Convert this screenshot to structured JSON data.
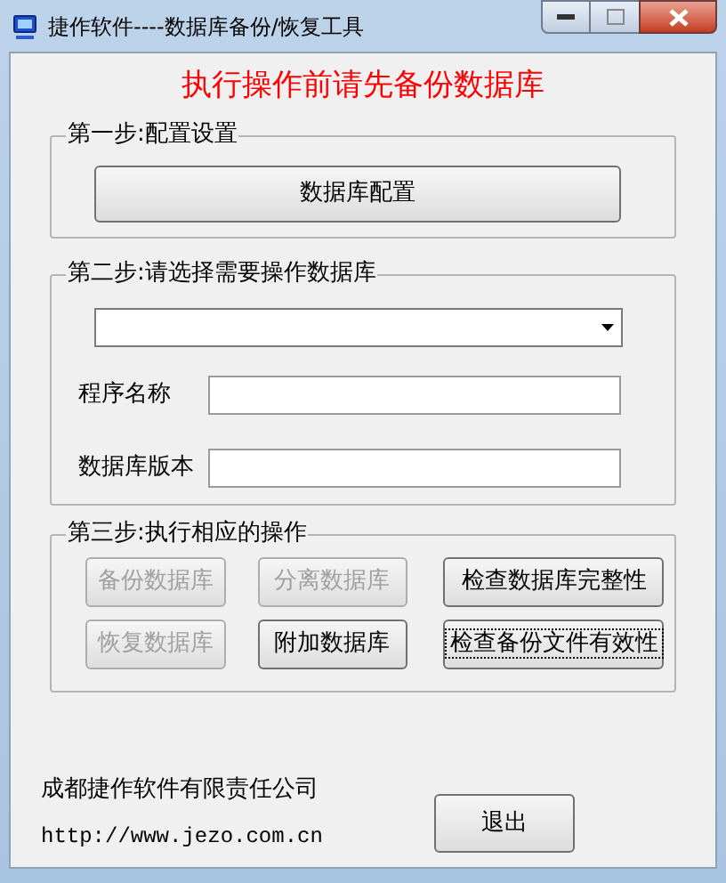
{
  "window": {
    "title": "捷作软件----数据库备份/恢复工具"
  },
  "warning": "执行操作前请先备份数据库",
  "step1": {
    "legend": "第一步:配置设置",
    "button": "数据库配置"
  },
  "step2": {
    "legend": "第二步:请选择需要操作数据库",
    "fields": [
      {
        "label": "程序名称"
      },
      {
        "label": "数据库版本"
      }
    ]
  },
  "step3": {
    "legend": "第三步:执行相应的操作",
    "buttons": [
      {
        "label": "备份数据库",
        "disabled": true,
        "focused": false
      },
      {
        "label": "分离数据库",
        "disabled": true,
        "focused": false
      },
      {
        "label": "检查数据库完整性",
        "disabled": false,
        "focused": false
      },
      {
        "label": "恢复数据库",
        "disabled": true,
        "focused": false
      },
      {
        "label": "附加数据库",
        "disabled": false,
        "focused": false
      },
      {
        "label": "检查备份文件有效性",
        "disabled": false,
        "focused": true
      }
    ]
  },
  "footer": {
    "company": "成都捷作软件有限责任公司",
    "url": "http://www.jezo.com.cn",
    "exit_button": "退出"
  }
}
